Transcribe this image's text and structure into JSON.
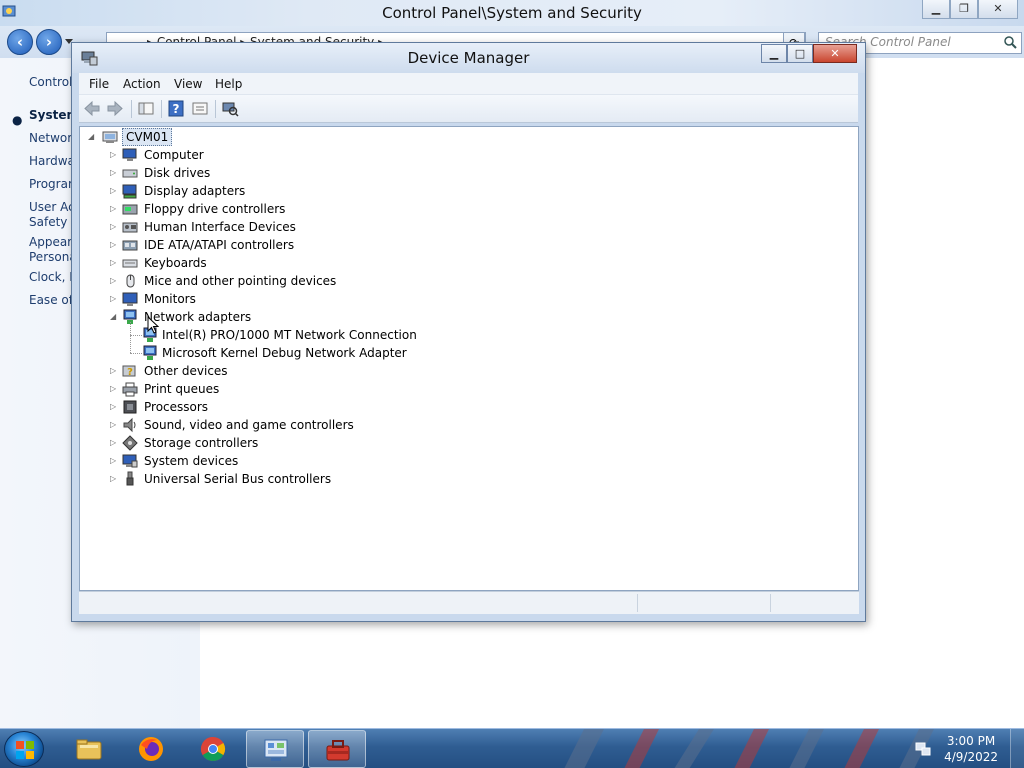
{
  "control_panel": {
    "title": "Control Panel\\System and Security",
    "breadcrumb": "▸ Control Panel ▸ System and Security ▸",
    "search_placeholder": "Search Control Panel",
    "sidebar": [
      {
        "label": "Control"
      },
      {
        "label": "System",
        "active": true
      },
      {
        "label": "Network"
      },
      {
        "label": "Hardwa"
      },
      {
        "label": "Program"
      },
      {
        "label": "User Ac\nSafety"
      },
      {
        "label": "Appeara\nPersona"
      },
      {
        "label": "Clock, L"
      },
      {
        "label": "Ease of"
      }
    ]
  },
  "device_manager": {
    "title": "Device Manager",
    "menu": [
      "File",
      "Action",
      "View",
      "Help"
    ],
    "root": "CVM01",
    "tree": [
      {
        "label": "Computer",
        "icon": "computer-icon",
        "expanded": false
      },
      {
        "label": "Disk drives",
        "icon": "disk-drive-icon",
        "expanded": false
      },
      {
        "label": "Display adapters",
        "icon": "display-adapter-icon",
        "expanded": false
      },
      {
        "label": "Floppy drive controllers",
        "icon": "floppy-controller-icon",
        "expanded": false
      },
      {
        "label": "Human Interface Devices",
        "icon": "hid-icon",
        "expanded": false
      },
      {
        "label": "IDE ATA/ATAPI controllers",
        "icon": "ide-controller-icon",
        "expanded": false
      },
      {
        "label": "Keyboards",
        "icon": "keyboard-icon",
        "expanded": false
      },
      {
        "label": "Mice and other pointing devices",
        "icon": "mouse-icon",
        "expanded": false
      },
      {
        "label": "Monitors",
        "icon": "monitor-icon",
        "expanded": false
      },
      {
        "label": "Network adapters",
        "icon": "network-adapter-icon",
        "expanded": true,
        "children": [
          {
            "label": "Intel(R) PRO/1000 MT Network Connection",
            "icon": "network-adapter-icon"
          },
          {
            "label": "Microsoft Kernel Debug Network Adapter",
            "icon": "network-adapter-icon"
          }
        ]
      },
      {
        "label": "Other devices",
        "icon": "unknown-device-icon",
        "expanded": false
      },
      {
        "label": "Print queues",
        "icon": "printer-icon",
        "expanded": false
      },
      {
        "label": "Processors",
        "icon": "processor-icon",
        "expanded": false
      },
      {
        "label": "Sound, video and game controllers",
        "icon": "speaker-icon",
        "expanded": false
      },
      {
        "label": "Storage controllers",
        "icon": "storage-controller-icon",
        "expanded": false
      },
      {
        "label": "System devices",
        "icon": "system-device-icon",
        "expanded": false
      },
      {
        "label": "Universal Serial Bus controllers",
        "icon": "usb-icon",
        "expanded": false
      }
    ]
  },
  "taskbar": {
    "apps": [
      {
        "name": "file-explorer-icon"
      },
      {
        "name": "firefox-icon"
      },
      {
        "name": "chrome-icon"
      },
      {
        "name": "control-panel-icon",
        "active": true
      },
      {
        "name": "toolbox-icon",
        "active": true
      }
    ],
    "time": "3:00 PM",
    "date": "4/9/2022"
  },
  "colors": {
    "taskbar": "#2f5d92",
    "window_frame": "#c9d9ed",
    "selection": "#dbe6f4",
    "close_button": "#c9462f"
  }
}
